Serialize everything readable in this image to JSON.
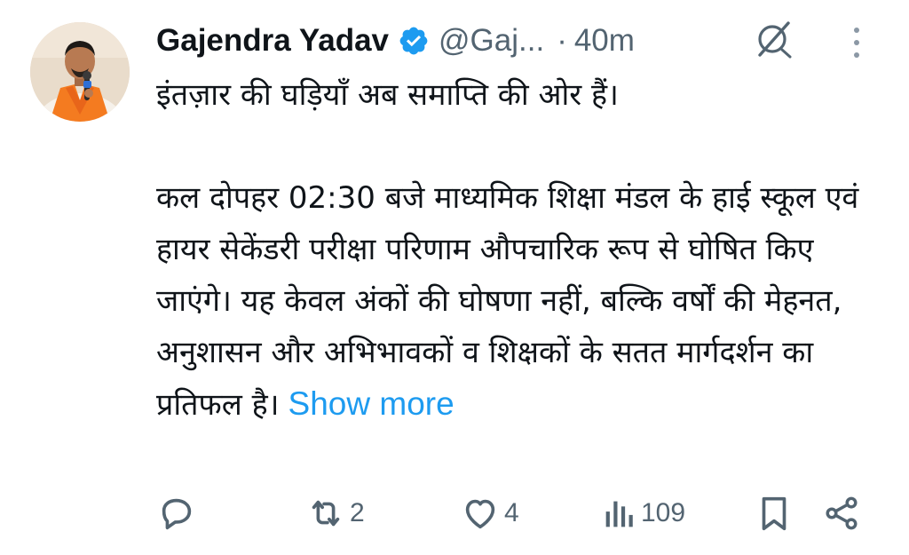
{
  "post": {
    "author_name": "Gajendra Yadav",
    "handle": "@Gaj...",
    "separator": "·",
    "time": "40m",
    "paragraphs": [
      "इंतज़ार की घड़ियाँ अब समाप्ति की ओर हैं।",
      "कल दोपहर 02:30 बजे माध्यमिक शिक्षा मंडल के हाई स्कूल एवं हायर सेकेंडरी परीक्षा परिणाम औपचारिक रूप से घोषित किए जाएंगे। यह केवल अंकों की घोषणा नहीं, बल्कि वर्षों की मेहनत, अनुशासन और अभिभावकों व शिक्षकों के सतत मार्गदर्शन का प्रतिफल है।"
    ],
    "show_more": "Show more"
  },
  "actions": {
    "retweets": "2",
    "likes": "4",
    "views": "109"
  },
  "colors": {
    "accent": "#1d9bf0",
    "muted": "#536471",
    "text": "#0f1419",
    "saffron": "#f47b20"
  },
  "icons": [
    "verified-badge-icon",
    "grok-icon",
    "more-vertical-icon",
    "reply-icon",
    "retweet-icon",
    "like-icon",
    "views-icon",
    "bookmark-icon",
    "share-icon"
  ]
}
